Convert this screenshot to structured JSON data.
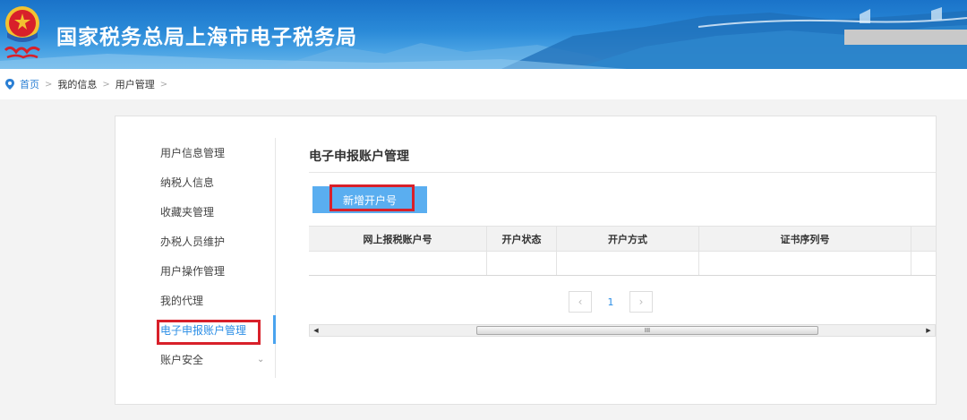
{
  "banner": {
    "title": "国家税务总局上海市电子税务局"
  },
  "breadcrumb": {
    "home": "首页",
    "items": [
      "我的信息",
      "用户管理"
    ],
    "separator": ">"
  },
  "sidebar": {
    "items": [
      {
        "label": "用户信息管理"
      },
      {
        "label": "纳税人信息"
      },
      {
        "label": "收藏夹管理"
      },
      {
        "label": "办税人员维护"
      },
      {
        "label": "用户操作管理"
      },
      {
        "label": "我的代理"
      },
      {
        "label": "电子申报账户管理",
        "active": true
      },
      {
        "label": "账户安全",
        "expandable": true
      }
    ]
  },
  "main": {
    "section_title": "电子申报账户管理",
    "add_button": "新增开户号",
    "table": {
      "columns": [
        "网上报税账户号",
        "开户状态",
        "开户方式",
        "证书序列号",
        ""
      ],
      "rows": [
        [
          "",
          "",
          "",
          "",
          ""
        ]
      ]
    },
    "pager": {
      "current": "1",
      "prev": "‹",
      "next": "›"
    },
    "scrollbar": {
      "left_arrow": "◀",
      "right_arrow": "▶",
      "grip": "III"
    }
  },
  "colors": {
    "accent": "#2b8ee6",
    "button": "#5aaef0",
    "highlight": "#d8202a",
    "banner": "#1a73c9"
  }
}
